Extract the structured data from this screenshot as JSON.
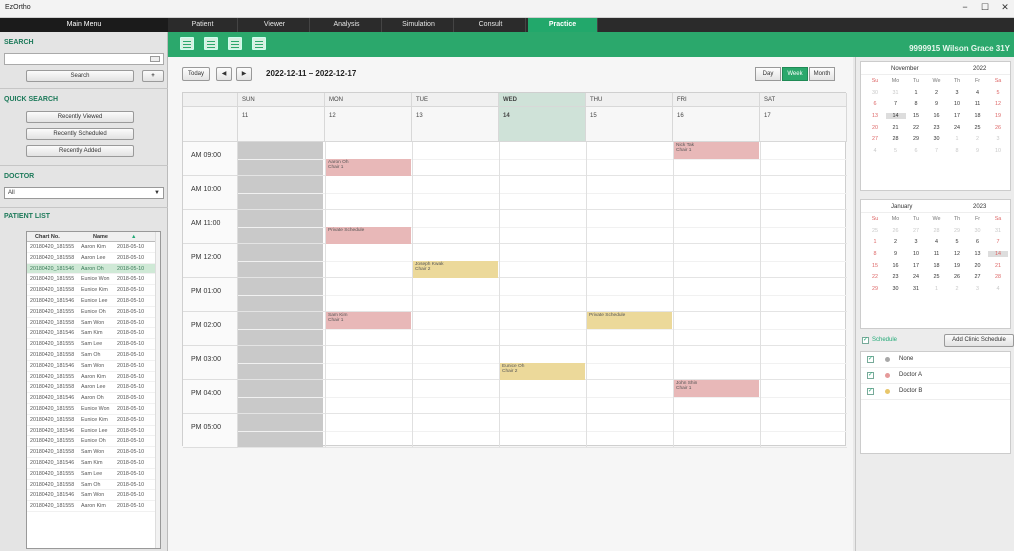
{
  "app": {
    "title": "EzOrtho",
    "minimize": "−",
    "maximize": "☐",
    "close": "✕"
  },
  "menu": {
    "header": "Main Menu",
    "tabs": [
      "Patient",
      "Viewer",
      "Analysis",
      "Simulation",
      "Consult",
      "Practice"
    ],
    "active_tab": "Practice"
  },
  "sidebar": {
    "search_title": "SEARCH",
    "search_placeholder": "",
    "search_button": "Search",
    "add_button": "+",
    "quick_search_title": "QUICK SEARCH",
    "quick_buttons": [
      "Recently Viewed",
      "Recently Scheduled",
      "Recently Added"
    ],
    "doctor_title": "DOCTOR",
    "doctor_selected": "All",
    "patient_list_title": "PATIENT LIST",
    "patient_columns": [
      "Chart No.",
      "Name",
      "▲"
    ],
    "patients": [
      [
        "20180420_181555",
        "Aaron Kim",
        "2018-05-10"
      ],
      [
        "20180420_181558",
        "Aaron Lee",
        "2018-05-10"
      ],
      [
        "20180420_181546",
        "Aaron Oh",
        "2018-05-10"
      ],
      [
        "20180420_181555",
        "Eunice Won",
        "2018-05-10"
      ],
      [
        "20180420_181558",
        "Eunice Kim",
        "2018-05-10"
      ],
      [
        "20180420_181546",
        "Eunice Lee",
        "2018-05-10"
      ],
      [
        "20180420_181555",
        "Eunice Oh",
        "2018-05-10"
      ],
      [
        "20180420_181558",
        "Sam Won",
        "2018-05-10"
      ],
      [
        "20180420_181546",
        "Sam Kim",
        "2018-05-10"
      ],
      [
        "20180420_181555",
        "Sam Lee",
        "2018-05-10"
      ],
      [
        "20180420_181558",
        "Sam Oh",
        "2018-05-10"
      ],
      [
        "20180420_181546",
        "Sam Won",
        "2018-05-10"
      ],
      [
        "20180420_181555",
        "Aaron Kim",
        "2018-05-10"
      ],
      [
        "20180420_181558",
        "Aaron Lee",
        "2018-05-10"
      ],
      [
        "20180420_181546",
        "Aaron Oh",
        "2018-05-10"
      ],
      [
        "20180420_181555",
        "Eunice Won",
        "2018-05-10"
      ],
      [
        "20180420_181558",
        "Eunice Kim",
        "2018-05-10"
      ],
      [
        "20180420_181546",
        "Eunice Lee",
        "2018-05-10"
      ],
      [
        "20180420_181555",
        "Eunice Oh",
        "2018-05-10"
      ],
      [
        "20180420_181558",
        "Sam Won",
        "2018-05-10"
      ],
      [
        "20180420_181546",
        "Sam Kim",
        "2018-05-10"
      ],
      [
        "20180420_181555",
        "Sam Lee",
        "2018-05-10"
      ],
      [
        "20180420_181558",
        "Sam Oh",
        "2018-05-10"
      ],
      [
        "20180420_181546",
        "Sam Won",
        "2018-05-10"
      ],
      [
        "20180420_181555",
        "Aaron Kim",
        "2018-05-10"
      ]
    ],
    "selected_patient_index": 2
  },
  "toolbar": {
    "icons": [
      "schedule-add-icon",
      "schedule-edit-icon",
      "schedule-delete-icon",
      "print-icon"
    ],
    "patient_banner": "9999915  Wilson Grace 31Y"
  },
  "calendar": {
    "today_button": "Today",
    "prev": "◀",
    "next": "▶",
    "range": "2022-12-11 – 2022-12-17",
    "views": [
      "Day",
      "Week",
      "Month"
    ],
    "active_view": "Week",
    "days": [
      {
        "dow": "SUN",
        "date": "11"
      },
      {
        "dow": "MON",
        "date": "12"
      },
      {
        "dow": "TUE",
        "date": "13"
      },
      {
        "dow": "WED",
        "date": "14"
      },
      {
        "dow": "THU",
        "date": "15"
      },
      {
        "dow": "FRI",
        "date": "16"
      },
      {
        "dow": "SAT",
        "date": "17"
      }
    ],
    "today_index": 3,
    "times": [
      "AM 09:00",
      "AM 10:00",
      "AM 11:00",
      "PM 12:00",
      "PM 01:00",
      "PM 02:00",
      "PM 03:00",
      "PM 04:00",
      "PM 05:00"
    ],
    "events": [
      {
        "day": 5,
        "slot": 0,
        "half": 0,
        "color": "pink",
        "line1": "Nick Tak",
        "line2": "Chair 1"
      },
      {
        "day": 1,
        "slot": 0,
        "half": 1,
        "color": "pink",
        "line1": "Aaron Oh",
        "line2": "Chair 1"
      },
      {
        "day": 1,
        "slot": 2,
        "half": 1,
        "color": "pink",
        "line1": "Private Schedule",
        "line2": ""
      },
      {
        "day": 2,
        "slot": 3,
        "half": 1,
        "color": "yellow",
        "line1": "Joseph Kwak",
        "line2": "Chair 2"
      },
      {
        "day": 1,
        "slot": 5,
        "half": 0,
        "color": "pink",
        "line1": "Sam Kim",
        "line2": "Chair 1"
      },
      {
        "day": 4,
        "slot": 5,
        "half": 0,
        "color": "yellow",
        "line1": "Private Schedule",
        "line2": ""
      },
      {
        "day": 3,
        "slot": 6,
        "half": 1,
        "color": "yellow",
        "line1": "Eunice Oh",
        "line2": "Chair 2"
      },
      {
        "day": 5,
        "slot": 7,
        "half": 0,
        "color": "pink",
        "line1": "John Shin",
        "line2": "Chair 1"
      }
    ]
  },
  "minicals": [
    {
      "month": "November",
      "year": "2022",
      "dow": [
        "Su",
        "Mo",
        "Tu",
        "We",
        "Th",
        "Fr",
        "Sa"
      ],
      "weeks": [
        [
          "30",
          "31",
          "1",
          "2",
          "3",
          "4",
          "5"
        ],
        [
          "6",
          "7",
          "8",
          "9",
          "10",
          "11",
          "12"
        ],
        [
          "13",
          "14",
          "15",
          "16",
          "17",
          "18",
          "19"
        ],
        [
          "20",
          "21",
          "22",
          "23",
          "24",
          "25",
          "26"
        ],
        [
          "27",
          "28",
          "29",
          "30",
          "1",
          "2",
          "3"
        ],
        [
          "4",
          "5",
          "6",
          "7",
          "8",
          "9",
          "10"
        ]
      ],
      "dim": [
        [
          0,
          0
        ],
        [
          0,
          1
        ],
        [
          4,
          4
        ],
        [
          4,
          5
        ],
        [
          4,
          6
        ],
        [
          5,
          0
        ],
        [
          5,
          1
        ],
        [
          5,
          2
        ],
        [
          5,
          3
        ],
        [
          5,
          4
        ],
        [
          5,
          5
        ],
        [
          5,
          6
        ]
      ],
      "selected": [
        2,
        1
      ]
    },
    {
      "month": "January",
      "year": "2023",
      "dow": [
        "Su",
        "Mo",
        "Tu",
        "We",
        "Th",
        "Fr",
        "Sa"
      ],
      "weeks": [
        [
          "25",
          "26",
          "27",
          "28",
          "29",
          "30",
          "31"
        ],
        [
          "1",
          "2",
          "3",
          "4",
          "5",
          "6",
          "7"
        ],
        [
          "8",
          "9",
          "10",
          "11",
          "12",
          "13",
          "14"
        ],
        [
          "15",
          "16",
          "17",
          "18",
          "19",
          "20",
          "21"
        ],
        [
          "22",
          "23",
          "24",
          "25",
          "26",
          "27",
          "28"
        ],
        [
          "29",
          "30",
          "31",
          "1",
          "2",
          "3",
          "4"
        ]
      ],
      "dim": [
        [
          0,
          0
        ],
        [
          0,
          1
        ],
        [
          0,
          2
        ],
        [
          0,
          3
        ],
        [
          0,
          4
        ],
        [
          0,
          5
        ],
        [
          0,
          6
        ],
        [
          5,
          3
        ],
        [
          5,
          4
        ],
        [
          5,
          5
        ],
        [
          5,
          6
        ]
      ],
      "selected": [
        2,
        6
      ]
    }
  ],
  "schedule": {
    "label": "Schedule",
    "add_button": "Add Clinic Schedule",
    "items": [
      {
        "label": "None",
        "color": "#a8a8a8"
      },
      {
        "label": "Doctor A",
        "color": "#e59a9a"
      },
      {
        "label": "Doctor B",
        "color": "#e8c66a"
      }
    ]
  },
  "colors": {
    "accent": "#2ba86c",
    "event_pink": "#e8b8b8",
    "event_yellow": "#ecd99a"
  }
}
